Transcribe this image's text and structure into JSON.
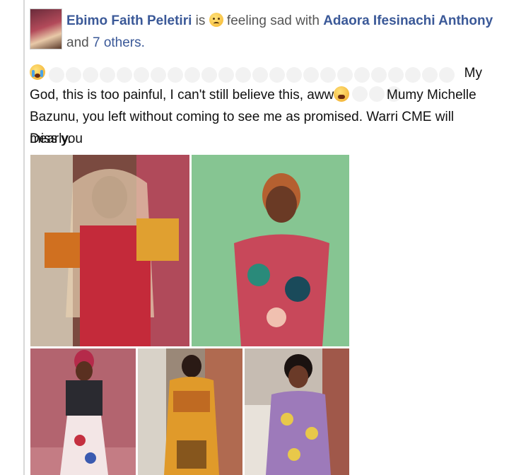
{
  "post": {
    "author": "Ebimo Faith Peletiri",
    "is_text": " is ",
    "feeling_text": " feeling sad with ",
    "tagged": "Adaora Ifesinachi Anthony",
    "and_text": " and ",
    "others": "7 others.",
    "feeling_icon": "sad-face-icon",
    "body_line1_tail": "My",
    "body_line2": "God, this is too painful, I can't still believe this, aww",
    "body_line2_tail": "Mumy Michelle",
    "body_line3": "Bazunu, you left without coming to see me as promised. Warri CME will miss you",
    "body_line4": "Dearly."
  },
  "photos": [
    {
      "name": "photo-1",
      "desc_icon": "photo"
    },
    {
      "name": "photo-2",
      "desc_icon": "photo"
    },
    {
      "name": "photo-3",
      "desc_icon": "photo"
    },
    {
      "name": "photo-4",
      "desc_icon": "photo"
    },
    {
      "name": "photo-5",
      "desc_icon": "photo"
    }
  ],
  "colors": {
    "link": "#3b5998",
    "text": "#111111",
    "muted": "#555555"
  }
}
